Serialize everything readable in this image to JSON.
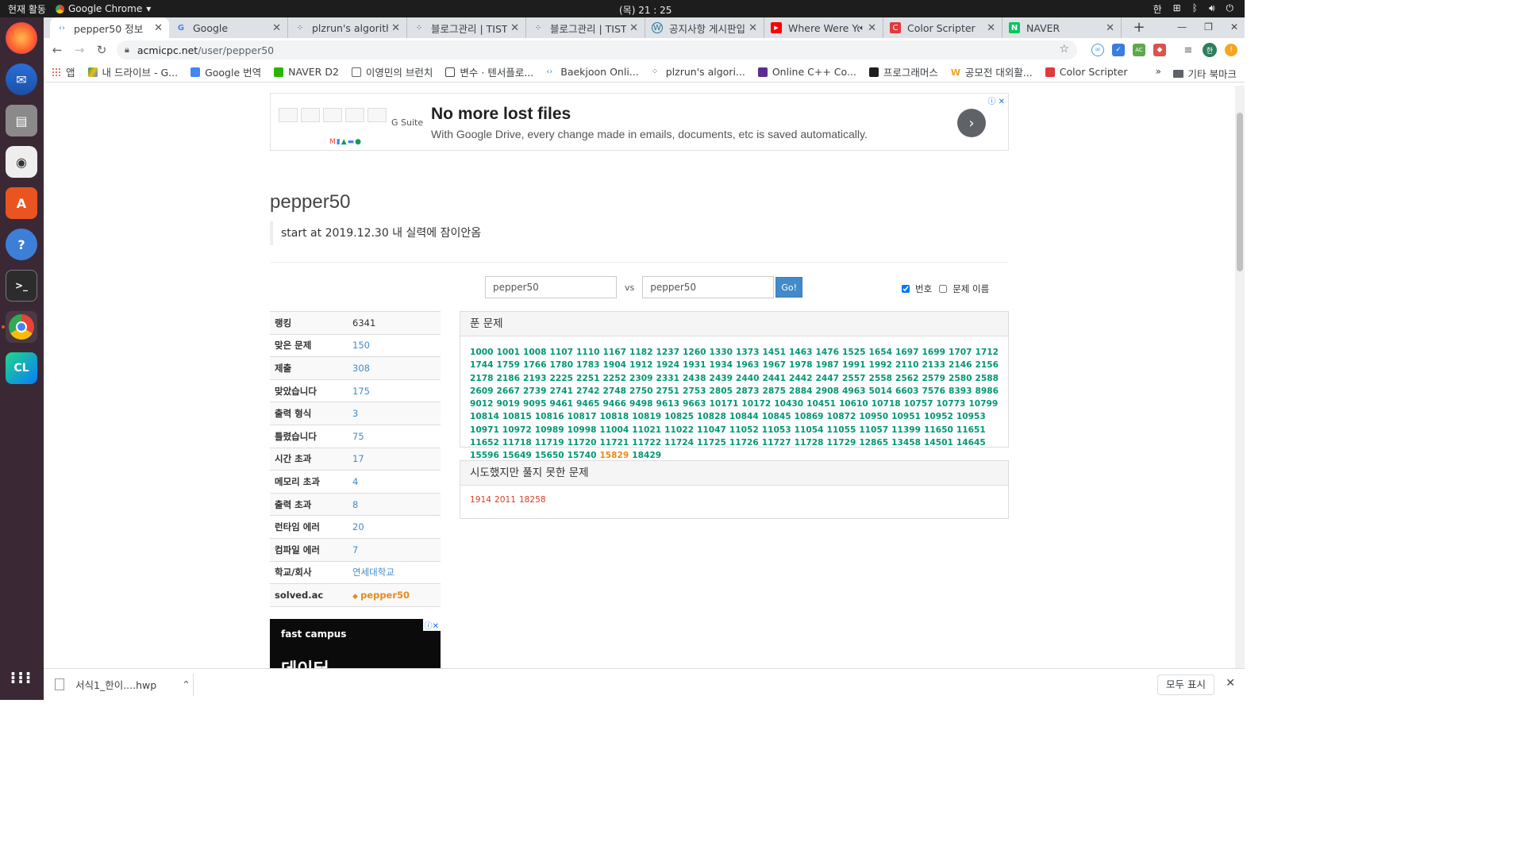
{
  "os": {
    "activities": "현재 활동",
    "app_name": "Google Chrome",
    "clock": "(목) 21 : 25",
    "input_method": "한"
  },
  "tabs": [
    {
      "title": "pepper50 정보",
      "active": true
    },
    {
      "title": "Google"
    },
    {
      "title": "plzrun's algorithm"
    },
    {
      "title": "블로그관리 | TISTORY"
    },
    {
      "title": "블로그관리 | TISTORY"
    },
    {
      "title": "공지사항 게시판입니다"
    },
    {
      "title": "Where Were You"
    },
    {
      "title": "Color Scripter"
    },
    {
      "title": "NAVER"
    }
  ],
  "url": {
    "host": "acmicpc.net",
    "path": "/user/pepper50"
  },
  "bookmarks": [
    "앱",
    "내 드라이브 - G...",
    "Google 번역",
    "NAVER D2",
    "이영민의 브런치",
    "변수 · 텐서플로...",
    "Baekjoon Onli...",
    "plzrun's algori...",
    "Online C++ Co...",
    "프로그래머스",
    "공모전 대외활...",
    "Color Scripter"
  ],
  "bookmarks_more": "»",
  "bookmarks_other": "기타 북마크",
  "ad": {
    "gsuite": "G Suite",
    "headline": "No more lost files",
    "sub": "With Google Drive, every change made in emails, documents, etc is saved automatically."
  },
  "profile": {
    "username": "pepper50",
    "motto": "start at 2019.12.30 내 실력에 잠이안옴"
  },
  "vs": {
    "left": "pepper50",
    "vs_label": "vs",
    "right": "pepper50",
    "go": "Go!",
    "opt_number": "번호",
    "opt_title": "문제 이름"
  },
  "stats": [
    {
      "k": "랭킹",
      "v": "6341",
      "style": "plain"
    },
    {
      "k": "맞은 문제",
      "v": "150"
    },
    {
      "k": "제출",
      "v": "308"
    },
    {
      "k": "맞았습니다",
      "v": "175"
    },
    {
      "k": "출력 형식",
      "v": "3"
    },
    {
      "k": "틀렸습니다",
      "v": "75"
    },
    {
      "k": "시간 초과",
      "v": "17"
    },
    {
      "k": "메모리 초과",
      "v": "4"
    },
    {
      "k": "출력 초과",
      "v": "8"
    },
    {
      "k": "런타임 에러",
      "v": "20"
    },
    {
      "k": "컴파일 에러",
      "v": "7"
    },
    {
      "k": "학교/회사",
      "v": "연세대학교"
    },
    {
      "k": "solved.ac",
      "v": "pepper50",
      "style": "orange"
    }
  ],
  "fastcampus": {
    "brand": "fast campus",
    "text": "데이터"
  },
  "solved_header": "푼 문제",
  "solved": [
    "1000",
    "1001",
    "1008",
    "1107",
    "1110",
    "1167",
    "1182",
    "1237",
    "1260",
    "1330",
    "1373",
    "1451",
    "1463",
    "1476",
    "1525",
    "1654",
    "1697",
    "1699",
    "1707",
    "1712",
    "1744",
    "1759",
    "1766",
    "1780",
    "1783",
    "1904",
    "1912",
    "1924",
    "1931",
    "1934",
    "1963",
    "1967",
    "1978",
    "1987",
    "1991",
    "1992",
    "2110",
    "2133",
    "2146",
    "2156",
    "2178",
    "2186",
    "2193",
    "2225",
    "2251",
    "2252",
    "2309",
    "2331",
    "2438",
    "2439",
    "2440",
    "2441",
    "2442",
    "2447",
    "2557",
    "2558",
    "2562",
    "2579",
    "2580",
    "2588",
    "2609",
    "2667",
    "2739",
    "2741",
    "2742",
    "2748",
    "2750",
    "2751",
    "2753",
    "2805",
    "2873",
    "2875",
    "2884",
    "2908",
    "4963",
    "5014",
    "6603",
    "7576",
    "8393",
    "8986",
    "9012",
    "9019",
    "9095",
    "9461",
    "9465",
    "9466",
    "9498",
    "9613",
    "9663",
    "10171",
    "10172",
    "10430",
    "10451",
    "10610",
    "10718",
    "10757",
    "10773",
    "10799",
    "10814",
    "10815",
    "10816",
    "10817",
    "10818",
    "10819",
    "10825",
    "10828",
    "10844",
    "10845",
    "10869",
    "10872",
    "10950",
    "10951",
    "10952",
    "10953",
    "10971",
    "10972",
    "10989",
    "10998",
    "11004",
    "11021",
    "11022",
    "11047",
    "11052",
    "11053",
    "11054",
    "11055",
    "11057",
    "11399",
    "11650",
    "11651",
    "11652",
    "11718",
    "11719",
    "11720",
    "11721",
    "11722",
    "11724",
    "11725",
    "11726",
    "11727",
    "11728",
    "11729",
    "12865",
    "13458",
    "14501",
    "14645",
    "15596",
    "15649",
    "15650",
    "15740",
    "15829",
    "18429"
  ],
  "solved_highlight": "15829",
  "failed_header": "시도했지만 풀지 못한 문제",
  "failed": [
    "1914",
    "2011",
    "18258"
  ],
  "download": {
    "file": "서식1_한이....hwp",
    "show_all": "모두 표시"
  }
}
